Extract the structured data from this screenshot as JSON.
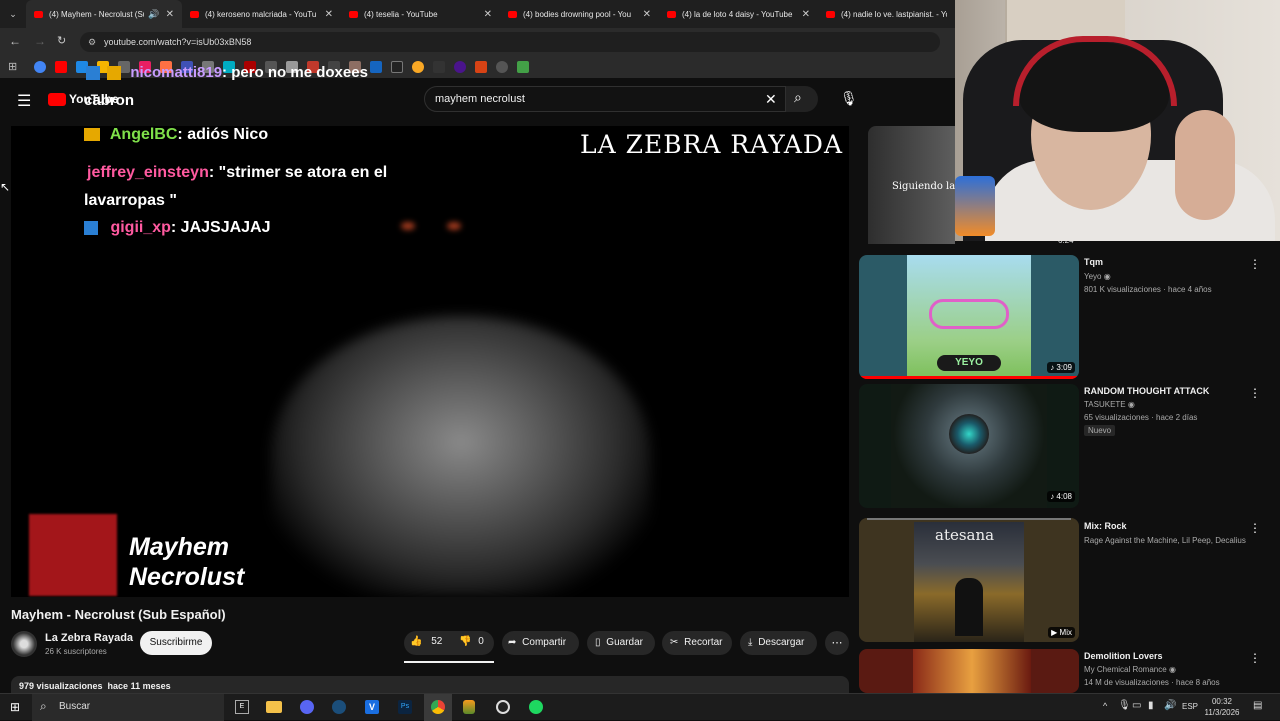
{
  "tabs": [
    {
      "label": "(4) Mayhem - Necrolust (Su"
    },
    {
      "label": "(4) keroseno malcriada - YouTu"
    },
    {
      "label": "(4) teselia - YouTube"
    },
    {
      "label": "(4) bodies drowning pool - You"
    },
    {
      "label": "(4) la de loto 4 daisy - YouTube"
    },
    {
      "label": "(4) nadie lo ve. lastpianist. - Yo"
    }
  ],
  "url": "youtube.com/watch?v=isUb03xBN58",
  "logo_text": "YouTube",
  "logo_overlay": "cabron",
  "search_value": "mayhem necrolust",
  "chat": [
    {
      "user": "nicomatti819",
      "msg": ": pero no me doxees"
    },
    {
      "user": "AngelBC",
      "msg": ": adiós Nico"
    },
    {
      "user": "jeffrey_einsteyn",
      "msg": ": \"strimer se atora en el lavarropas \""
    },
    {
      "user": "gigii_xp",
      "msg": ": JAJSJAJAJ"
    }
  ],
  "video": {
    "watermark": "LA ZEBRA RAYADA",
    "overlay_title_1": "Mayhem",
    "overlay_title_2": "Necrolust",
    "title": "Mayhem - Necrolust (Sub Español)",
    "channel": "La Zebra Rayada",
    "subs": "26 K suscriptores",
    "subscribe": "Suscribirme",
    "likes": "52",
    "dislikes": "0",
    "share": "Compartir",
    "save": "Guardar",
    "clip": "Recortar",
    "download": "Descargar",
    "stats": "979 visualizaciones  hace 11 meses"
  },
  "top_card": {
    "text": "Siguiendo la",
    "duration": "6:24"
  },
  "recs": [
    {
      "title": "Tqm",
      "channel": "Yeyo",
      "meta": "801 K visualizaciones · hace 4 años",
      "badge": "",
      "duration": "3:09"
    },
    {
      "title": "RANDOM THOUGHT ATTACK",
      "channel": "TASUKETE",
      "meta": "65 visualizaciones · hace 2 días",
      "badge": "Nuevo",
      "duration": "4:08"
    },
    {
      "title": "Mix: Rock",
      "channel": "Rage Against the Machine, Lil Peep, Decalius y ...",
      "meta": "",
      "badge": "",
      "duration": "Mix"
    },
    {
      "title": "Demolition Lovers",
      "channel": "My Chemical Romance",
      "meta": "14 M de visualizaciones · hace 8 años",
      "badge": "",
      "duration": ""
    }
  ],
  "thumb_texts": {
    "tqm": "YEYO",
    "atesana": "atesana"
  },
  "taskbar": {
    "search": "Buscar",
    "lang": "ESP",
    "time": "00:32",
    "date": "11/3/2026"
  },
  "colors": {
    "yt_red": "#ff0000",
    "chat_user_green": "#7fe04a",
    "chat_user_pink": "#ff5aa0",
    "chat_user_purple": "#c89cff"
  }
}
